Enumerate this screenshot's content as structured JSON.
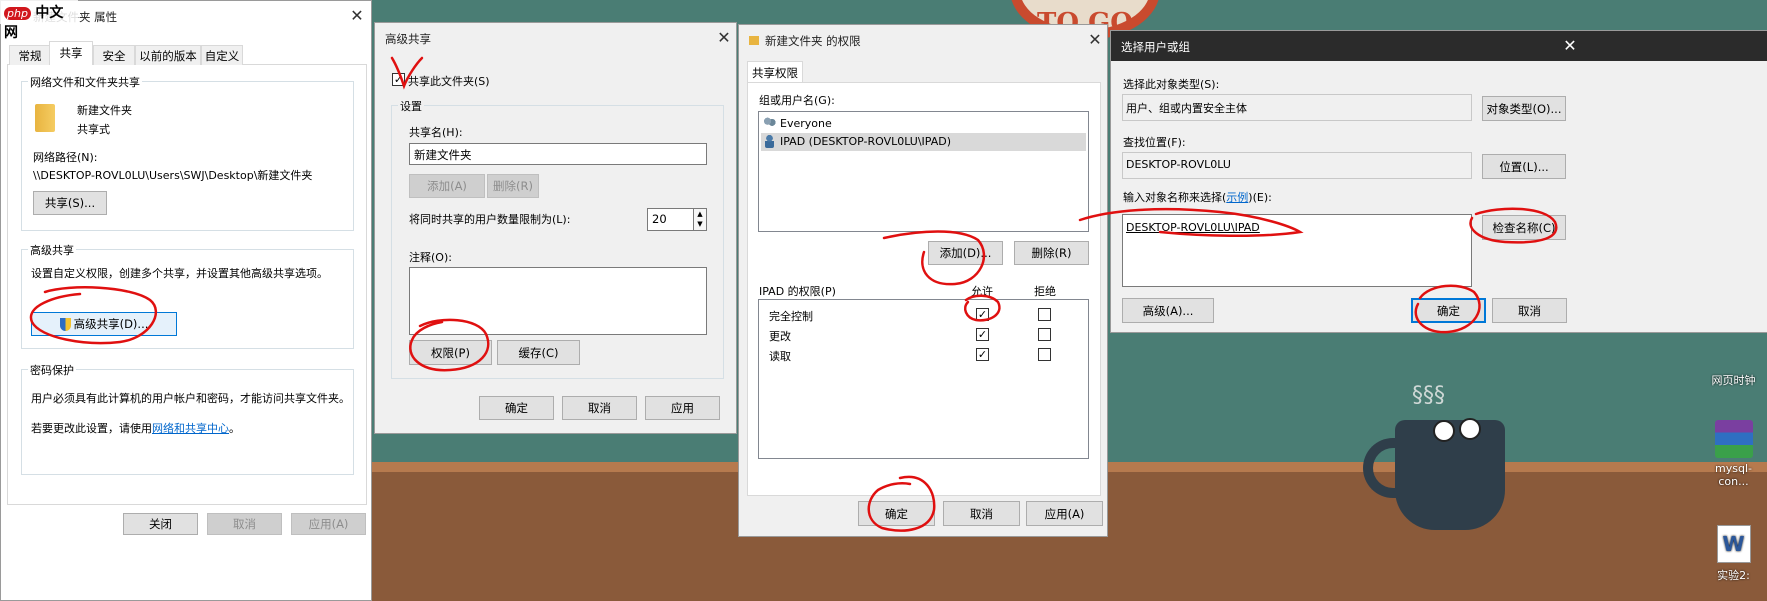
{
  "watermark": {
    "logo": "php",
    "text": "中文网"
  },
  "desktop": {
    "sign_text": "TO GO",
    "icons": [
      {
        "label": "网页时钟"
      },
      {
        "label": "mysql-con..."
      },
      {
        "label": "实验2:"
      }
    ]
  },
  "props": {
    "title": "新建文件夹 属性",
    "tabs": [
      "常规",
      "共享",
      "安全",
      "以前的版本",
      "自定义"
    ],
    "group1_label": "网络文件和文件夹共享",
    "folder_name": "新建文件夹",
    "folder_state": "共享式",
    "net_path_label": "网络路径(N):",
    "net_path": "\\\\DESKTOP-ROVL0LU\\Users\\SWJ\\Desktop\\新建文件夹",
    "share_button": "共享(S)...",
    "group2_label": "高级共享",
    "adv_desc": "设置自定义权限，创建多个共享，并设置其他高级共享选项。",
    "adv_button": "高级共享(D)...",
    "group3_label": "密码保护",
    "pw_desc": "用户必须具有此计算机的用户帐户和密码，才能访问共享文件夹。",
    "pw_change_prefix": "若要更改此设置，请使用",
    "pw_link": "网络和共享中心",
    "pw_change_suffix": "。",
    "close_btn": "关闭",
    "cancel_btn": "取消",
    "apply_btn": "应用(A)"
  },
  "adv": {
    "title": "高级共享",
    "share_checkbox": "共享此文件夹(S)",
    "share_checked": true,
    "settings_label": "设置",
    "share_name_label": "共享名(H):",
    "share_name": "新建文件夹",
    "add_btn": "添加(A)",
    "remove_btn": "删除(R)",
    "limit_label": "将同时共享的用户数量限制为(L):",
    "limit_value": "20",
    "note_label": "注释(O):",
    "perm_btn": "权限(P)",
    "cache_btn": "缓存(C)",
    "ok": "确定",
    "cancel": "取消",
    "apply": "应用"
  },
  "perm": {
    "title": "新建文件夹 的权限",
    "tab": "共享权限",
    "users_label": "组或用户名(G):",
    "users": [
      {
        "name": "Everyone",
        "icon": "group-icon",
        "selected": false
      },
      {
        "name": "IPAD (DESKTOP-ROVL0LU\\IPAD)",
        "icon": "user-icon",
        "selected": true
      }
    ],
    "add_btn": "添加(D)...",
    "remove_btn": "删除(R)",
    "perm_label": "IPAD 的权限(P)",
    "allow": "允许",
    "deny": "拒绝",
    "rows": [
      {
        "name": "完全控制",
        "allow": true,
        "deny": false
      },
      {
        "name": "更改",
        "allow": true,
        "deny": false
      },
      {
        "name": "读取",
        "allow": true,
        "deny": false
      }
    ],
    "ok": "确定",
    "cancel": "取消",
    "apply": "应用(A)"
  },
  "select": {
    "title": "选择用户或组",
    "type_label": "选择此对象类型(S):",
    "type_value": "用户、组或内置安全主体",
    "type_btn": "对象类型(O)...",
    "loc_label": "查找位置(F):",
    "loc_value": "DESKTOP-ROVL0LU",
    "loc_btn": "位置(L)...",
    "name_label_prefix": "输入对象名称来选择(",
    "name_label_link": "示例",
    "name_label_suffix": ")(E):",
    "name_value": "DESKTOP-ROVL0LU\\IPAD",
    "check_btn": "检查名称(C)",
    "adv_btn": "高级(A)...",
    "ok": "确定",
    "cancel": "取消"
  },
  "colors": {
    "accent": "#0078d7",
    "annotation": "#e01010",
    "link": "#0066cc"
  }
}
